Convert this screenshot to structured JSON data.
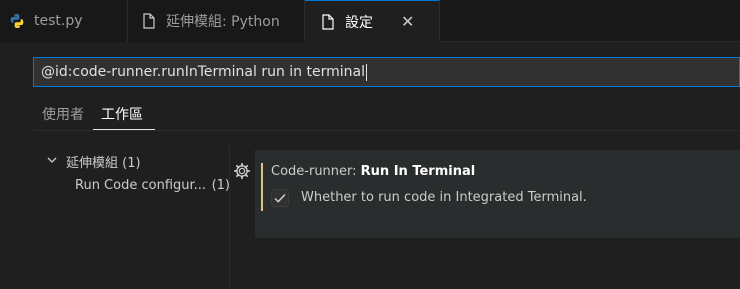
{
  "tabs": [
    {
      "label": "test.py",
      "icon": "python-icon"
    },
    {
      "label": "延伸模組: Python",
      "icon": "file-icon"
    },
    {
      "label": "設定",
      "icon": "file-icon",
      "close": "✕"
    }
  ],
  "search": {
    "value": "@id:code-runner.runInTerminal run in terminal"
  },
  "scope_tabs": [
    {
      "label": "使用者"
    },
    {
      "label": "工作區",
      "active": true
    }
  ],
  "toc": {
    "group_label": "延伸模組 (1)",
    "item_label": "Run Code configur...",
    "item_count": "(1)"
  },
  "setting": {
    "category": "Code-runner: ",
    "name": "Run In Terminal",
    "checked": true,
    "description": "Whether to run code in Integrated Terminal."
  },
  "colors": {
    "accent": "#0078d4",
    "modified_bar": "#e2c08d",
    "python_blue": "#3572A5",
    "python_yellow": "#FFD43B"
  }
}
